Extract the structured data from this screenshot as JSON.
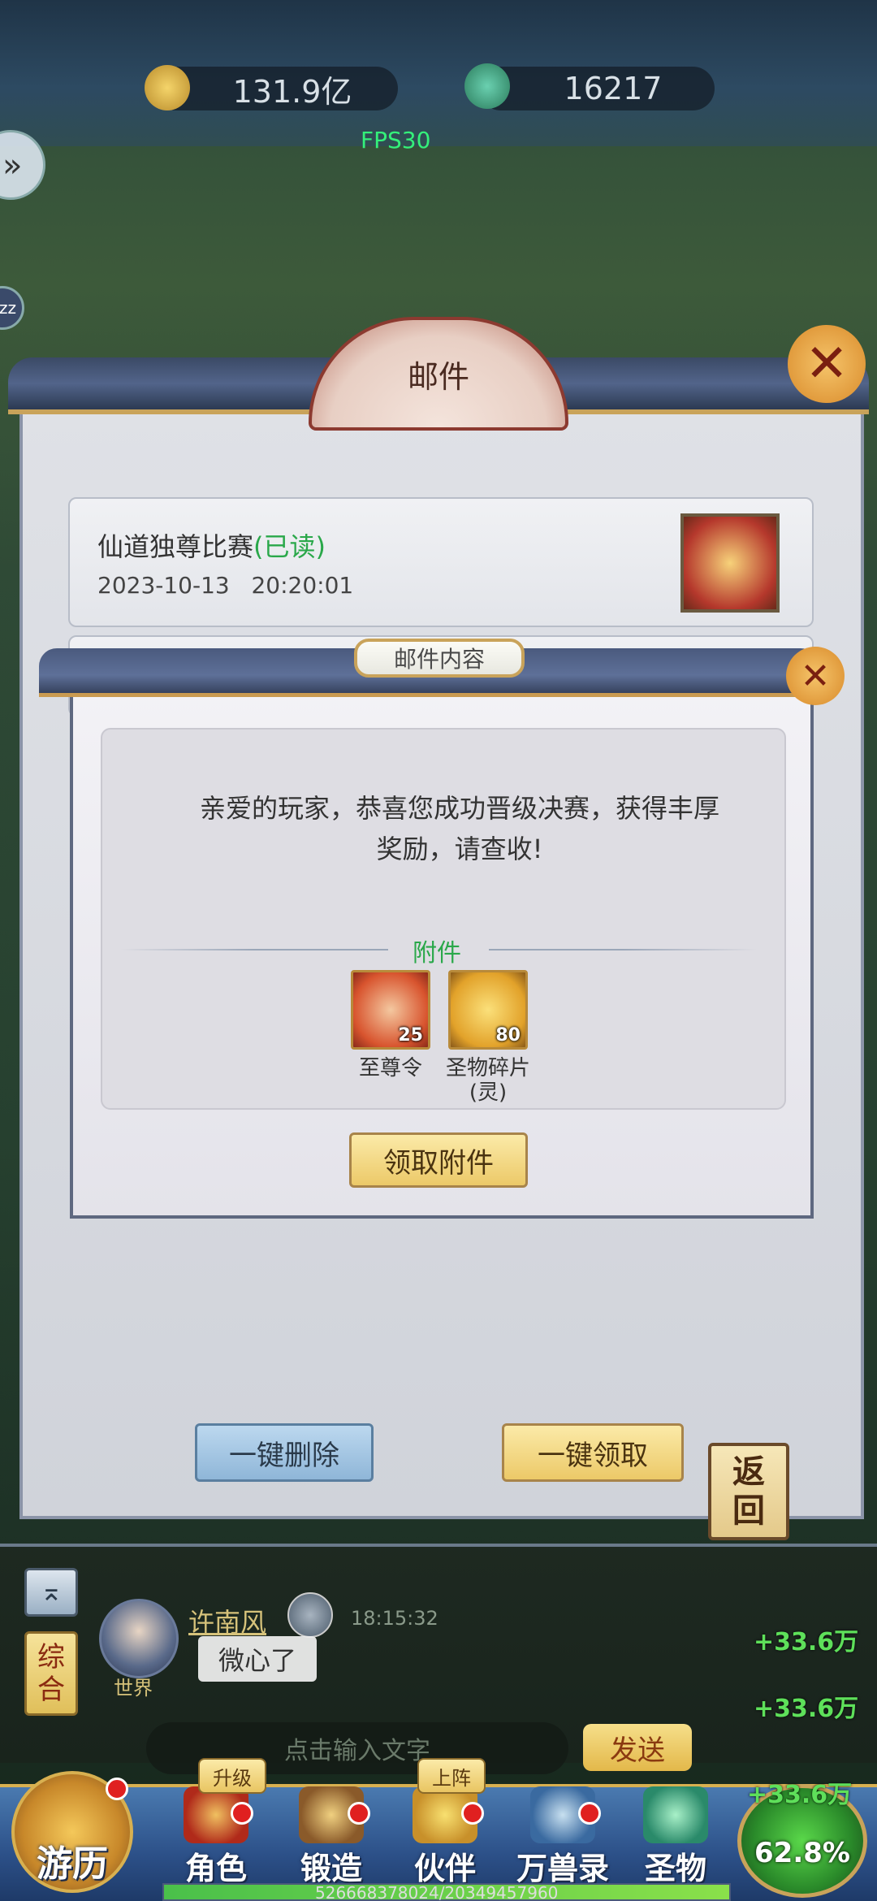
{
  "top": {
    "currency1": "131.9亿",
    "currency2": "16217",
    "fps": "FPS30"
  },
  "mail": {
    "title": "邮件",
    "items": [
      {
        "title": "仙道独尊比赛",
        "status": "(已读)",
        "date": "2023-10-13",
        "time": "20:20:01"
      }
    ],
    "delete_all": "一键删除",
    "claim_all": "一键领取",
    "return_label": "返回"
  },
  "dialog": {
    "title": "邮件内容",
    "message": "亲爱的玩家，恭喜您成功晋级决赛，获得丰厚奖励，请查收!",
    "attachments_title": "附件",
    "attachments": [
      {
        "name": "至尊令",
        "count": "25"
      },
      {
        "name": "圣物碎片(灵)",
        "count": "80"
      }
    ],
    "claim_button": "领取附件"
  },
  "chat": {
    "channel_tab": "综合",
    "username": "许南风",
    "time": "18:15:32",
    "message": "微心了",
    "world_tag": "世界",
    "input_placeholder": "点击输入文字",
    "send": "发送",
    "gains": [
      "+33.6万",
      "+33.6万",
      "+33.6万"
    ]
  },
  "nav": {
    "items": [
      "游历",
      "角色",
      "锻造",
      "伙伴",
      "万兽录",
      "圣物"
    ],
    "tag_upgrade": "升级",
    "tag_deploy": "上阵",
    "exp": "526668378024/20349457960",
    "percent": "62.8%"
  }
}
